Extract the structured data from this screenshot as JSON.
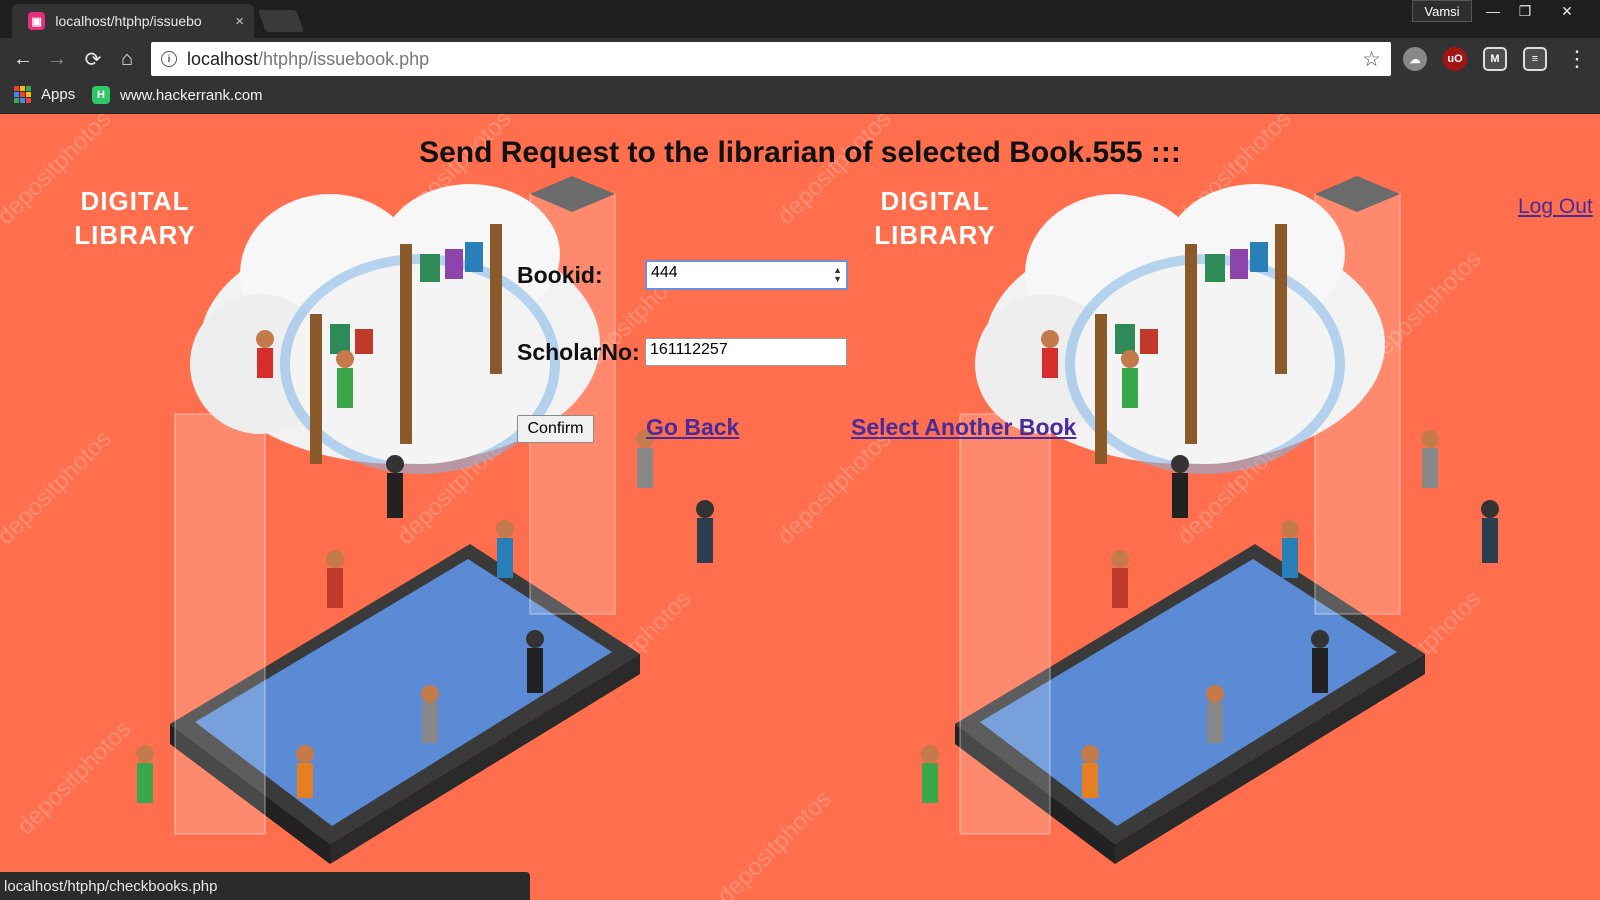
{
  "browser": {
    "tab_title": "localhost/htphp/issuebo",
    "tab_close": "×",
    "profile_name": "Vamsi",
    "window_controls": {
      "minimize": "—",
      "restore": "❐",
      "close": "✕"
    },
    "nav": {
      "back": "←",
      "forward": "→",
      "reload": "⟳",
      "home": "⌂"
    },
    "url_host": "localhost",
    "url_path": "/htphp/issuebook.php",
    "bookmarks": [
      {
        "label": "Apps",
        "icon": "apps-grid-icon"
      },
      {
        "label": "www.hackerrank.com",
        "icon": "hackerrank-icon"
      }
    ],
    "extensions": [
      "cloud-extension-icon",
      "ublock-icon",
      "malwarebytes-icon",
      "ticket-extension-icon"
    ],
    "menu": "⋮"
  },
  "page": {
    "heading": "Send Request to the librarian of selected Book.555 :::",
    "logout_label": "Log Out",
    "illustration_label_line1": "DIGITAL",
    "illustration_label_line2": "LIBRARY",
    "watermark": "depositphotos",
    "form": {
      "bookid_label": "Bookid:",
      "bookid_value": "444",
      "scholar_label": "ScholarNo:",
      "scholar_value": "161112257",
      "confirm_label": "Confirm",
      "go_back_label": "Go Back",
      "select_another_label": "Select Another Book"
    }
  },
  "status_bar": {
    "text": "localhost/htphp/checkbooks.php"
  },
  "colors": {
    "background": "#ff6f4d",
    "link": "#4b2a9a",
    "chrome": "#333333"
  }
}
